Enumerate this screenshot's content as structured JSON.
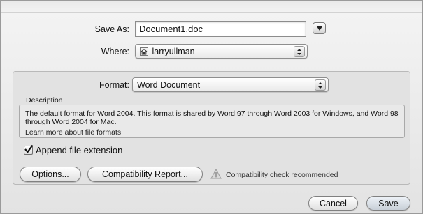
{
  "save_as": {
    "label": "Save As:",
    "value": "Document1.doc"
  },
  "where": {
    "label": "Where:",
    "value": "larryullman",
    "icon": "home-folder-icon"
  },
  "format": {
    "label": "Format:",
    "value": "Word Document"
  },
  "description": {
    "heading": "Description",
    "text": "The default format for Word 2004. This format is shared by Word 97 through Word 2003 for Windows, and Word 98 through Word 2004 for Mac.",
    "link": "Learn more about file formats"
  },
  "append_extension": {
    "label": "Append file extension",
    "checked": true
  },
  "buttons": {
    "options": "Options...",
    "compatibility_report": "Compatibility Report...",
    "cancel": "Cancel",
    "save": "Save"
  },
  "compat_warning": {
    "icon": "warning-triangle-icon",
    "text": "Compatibility check recommended"
  }
}
